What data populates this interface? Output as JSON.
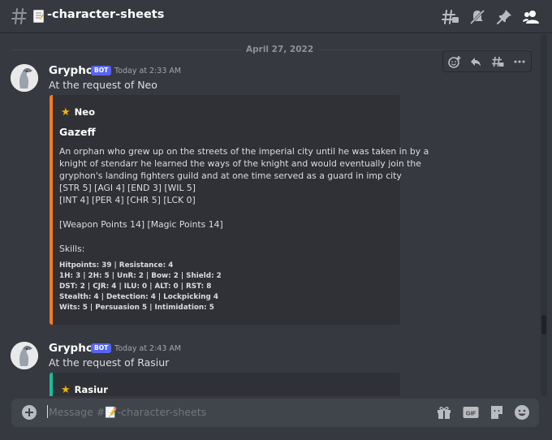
{
  "header": {
    "channel_name": "-character-sheets"
  },
  "date_divider": "April 27, 2022",
  "messages": [
    {
      "author": "Gryphon",
      "tag": "BOT",
      "timestamp": "Today at 2:33 AM",
      "content": "At the request of Neo",
      "embed": {
        "accent_color": "#f57c1f",
        "author": "Neo",
        "title": "Gazeff",
        "description_lines": [
          "An orphan who grew up on the streets of the imperial city until he was taken in by a",
          "knight of stendarr he learned the ways of the knight and would eventually join the",
          "gryphon's landing fighters guild and at one time served as a guard in imp city",
          "[STR 5] [AGI 4] [END 3] [WIL 5]",
          "[INT 4] [PER 4] [CHR 5] [LCK 0]",
          "[Weapon Points 14] [Magic Points 14]",
          "Skills:"
        ],
        "skills_lines": [
          "Hitpoints: 39 | Resistance: 4",
          "1H: 3 | 2H: 5 | UnR: 2 | Bow: 2 | Shield: 2",
          "DST: 2 | CJR: 4 | ILU: 0 | ALT: 0 | RST: 8",
          "Stealth: 4 | Detection: 4 | Lockpicking 4",
          "Wits: 5 | Persuasion 5 | Intimidation: 5"
        ]
      }
    },
    {
      "author": "Gryphon",
      "tag": "BOT",
      "timestamp": "Today at 2:43 AM",
      "content": "At the request of Rasiur",
      "embed": {
        "accent_color": "#1abc9c",
        "author": "Rasiur"
      }
    }
  ],
  "composer": {
    "placeholder": "Message #📝-character-sheets"
  },
  "colors": {
    "background": "#36393f",
    "embed_background": "#2f3136",
    "bot_tag": "#5865f2",
    "star": "#f4b400"
  }
}
